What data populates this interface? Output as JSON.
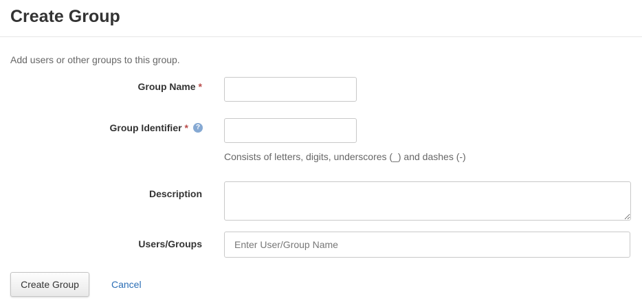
{
  "header": {
    "title": "Create Group"
  },
  "form": {
    "intro": "Add users or other groups to this group.",
    "required_marker": "*",
    "group_name": {
      "label": "Group Name",
      "value": ""
    },
    "group_identifier": {
      "label": "Group Identifier",
      "value": "",
      "help_icon": "question-circle-icon",
      "help_glyph": "?",
      "hint": "Consists of letters, digits, underscores (_) and dashes (-)"
    },
    "description": {
      "label": "Description",
      "value": ""
    },
    "users_groups": {
      "label": "Users/Groups",
      "value": "",
      "placeholder": "Enter User/Group Name"
    }
  },
  "actions": {
    "create_label": "Create Group",
    "cancel_label": "Cancel"
  },
  "colors": {
    "required": "#b94a48",
    "link": "#2a6db5",
    "help_icon": "#86a9d3"
  }
}
